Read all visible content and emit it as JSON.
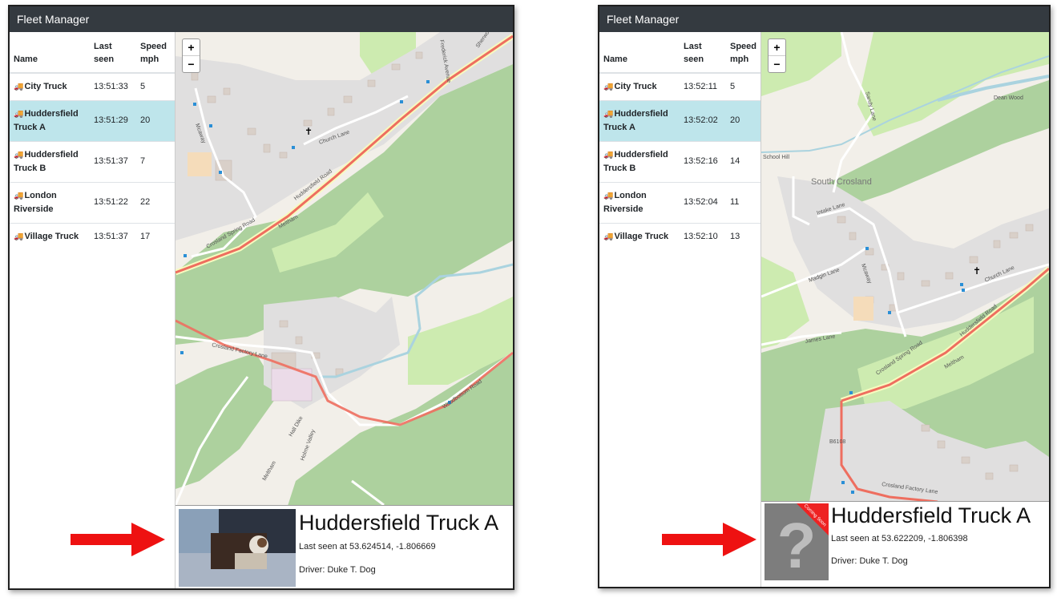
{
  "left": {
    "title": "Fleet Manager",
    "columns": {
      "name": "Name",
      "last_seen": "Last seen",
      "speed": "Speed mph"
    },
    "rows": [
      {
        "name": "City Truck",
        "last_seen": "13:51:33",
        "speed": "5"
      },
      {
        "name": "Huddersfield Truck A",
        "last_seen": "13:51:29",
        "speed": "20"
      },
      {
        "name": "Huddersfield Truck B",
        "last_seen": "13:51:37",
        "speed": "7"
      },
      {
        "name": "London Riverside",
        "last_seen": "13:51:22",
        "speed": "22"
      },
      {
        "name": "Village Truck",
        "last_seen": "13:51:37",
        "speed": "17"
      }
    ],
    "selected_row": 1,
    "zoom": {
      "in": "+",
      "out": "−"
    },
    "map_labels": {
      "church_lane": "Church Lane",
      "huddersfield_road": "Huddersfield Road",
      "crosland_spring_road": "Crosland Spring Road",
      "crosland_factory_lane": "Crosland Factory Lane",
      "woodbottom_road": "Woodbottom Road",
      "meltham": "Meltham",
      "mcaway": "Mcaway",
      "hall_dike": "Hall Dike",
      "holme_valley": "Holme Valley",
      "frederick_avenue": "Frederick Avenue",
      "sherwood": "Sherwood",
      "meltham_road": "Meltham Road"
    },
    "info": {
      "title": "Huddersfield Truck A",
      "last_seen": "Last seen at 53.624514, -1.806669",
      "driver": "Driver: Duke T. Dog"
    }
  },
  "right": {
    "title": "Fleet Manager",
    "columns": {
      "name": "Name",
      "last_seen": "Last seen",
      "speed": "Speed mph"
    },
    "rows": [
      {
        "name": "City Truck",
        "last_seen": "13:52:11",
        "speed": "5"
      },
      {
        "name": "Huddersfield Truck A",
        "last_seen": "13:52:02",
        "speed": "20"
      },
      {
        "name": "Huddersfield Truck B",
        "last_seen": "13:52:16",
        "speed": "14"
      },
      {
        "name": "London Riverside",
        "last_seen": "13:52:04",
        "speed": "11"
      },
      {
        "name": "Village Truck",
        "last_seen": "13:52:10",
        "speed": "13"
      }
    ],
    "selected_row": 1,
    "zoom": {
      "in": "+",
      "out": "−"
    },
    "map_labels": {
      "south_crosland": "South Crosland",
      "dean_wood": "Dean Wood",
      "school_hill": "School Hill",
      "intake_lane": "Intake Lane",
      "madgin_lane": "Madgin Lane",
      "church_lane": "Church Lane",
      "huddersfield_road": "Huddersfield Road",
      "crosland_spring_road": "Crosland Spring Road",
      "james_lane": "James Lane",
      "crosland_factory_lane": "Crosland Factory Lane",
      "b6108": "B6108",
      "sandy_lane": "Sandy Lane",
      "meltham": "Meltham",
      "mcaway": "Mcaway"
    },
    "photo_ribbon": "Coming Soon",
    "info": {
      "title": "Huddersfield Truck A",
      "last_seen": "Last seen at 53.622209, -1.806398",
      "driver": "Driver: Duke T. Dog"
    }
  },
  "colors": {
    "titlebar": "#343a40",
    "selected_row": "#bee5eb",
    "map_land": "#f2efe9",
    "map_woods": "#add19e",
    "map_grass": "#cdebb0",
    "map_buildings": "#d9d0c9",
    "route": "#ee6e5f",
    "arrow": "#ee1111"
  },
  "icons": [
    "truck-icon",
    "zoom-in-icon",
    "zoom-out-icon",
    "church-icon",
    "red-arrow-icon",
    "question-mark-icon"
  ]
}
